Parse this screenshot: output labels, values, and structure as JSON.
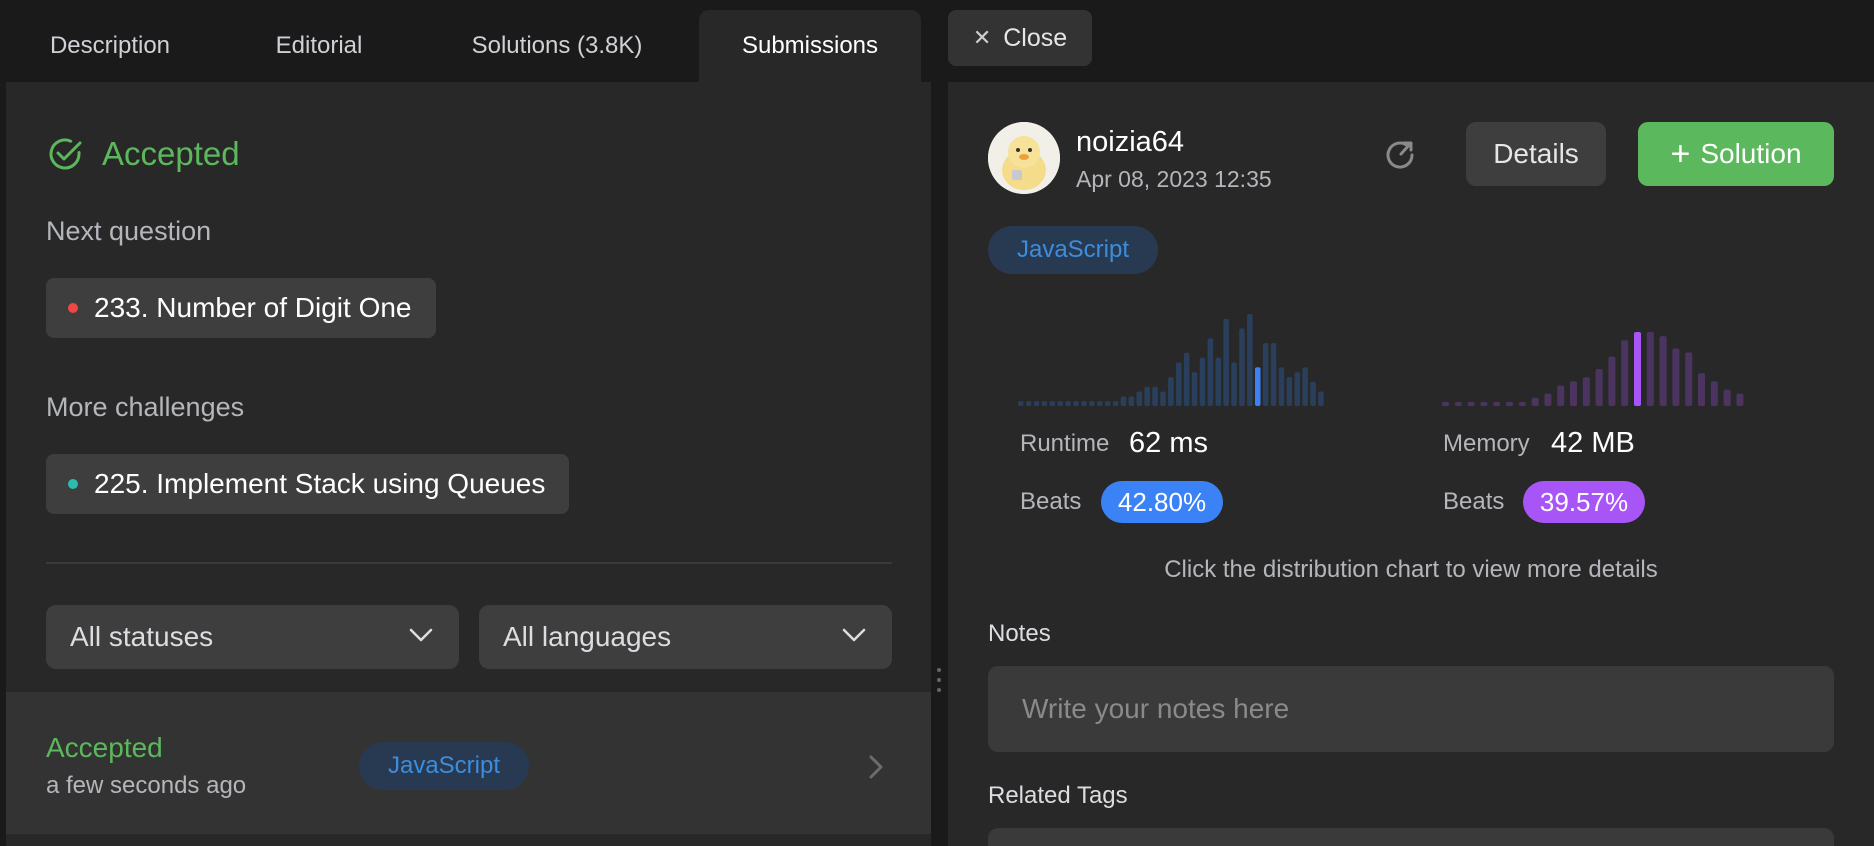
{
  "tabs": [
    {
      "label": "Description"
    },
    {
      "label": "Editorial"
    },
    {
      "label": "Solutions (3.8K)"
    },
    {
      "label": "Submissions"
    }
  ],
  "close_label": "Close",
  "result": {
    "status": "Accepted",
    "next_question_title": "Next question",
    "next_question": "233. Number of Digit One",
    "next_question_color": "#ef4743",
    "more_challenges_title": "More challenges",
    "more_challenge": "225. Implement Stack using Queues",
    "more_challenge_color": "#2cbcad"
  },
  "filters": {
    "status": "All statuses",
    "language": "All languages"
  },
  "submission_row": {
    "status": "Accepted",
    "time": "a few seconds ago",
    "language": "JavaScript"
  },
  "submission": {
    "username": "noizia64",
    "date": "Apr 08, 2023 12:35",
    "details_label": "Details",
    "solution_label": "Solution",
    "language": "JavaScript"
  },
  "runtime": {
    "label": "Runtime",
    "value": "62 ms",
    "beats_label": "Beats",
    "beats": "42.80%",
    "accent": "#3b82f6",
    "bars": [
      1,
      1,
      1,
      1,
      1,
      1,
      1,
      1,
      1,
      1,
      1,
      1,
      1,
      2,
      2,
      3,
      4,
      4,
      3,
      6,
      9,
      11,
      7,
      10,
      14,
      10,
      18,
      9,
      16,
      19,
      8,
      13,
      13,
      8,
      6,
      7,
      8,
      5,
      3
    ],
    "highlight_index": 30
  },
  "memory": {
    "label": "Memory",
    "value": "42 MB",
    "beats_label": "Beats",
    "beats": "39.57%",
    "accent": "#a855f7",
    "bars": [
      1,
      1,
      1,
      1,
      1,
      1,
      1,
      2,
      3,
      5,
      6,
      7,
      9,
      12,
      16,
      18,
      18,
      17,
      14,
      13,
      8,
      6,
      4,
      3
    ],
    "highlight_index": 15
  },
  "hint": "Click the distribution chart to view more details",
  "notes": {
    "title": "Notes",
    "placeholder": "Write your notes here"
  },
  "related_tags_title": "Related Tags"
}
